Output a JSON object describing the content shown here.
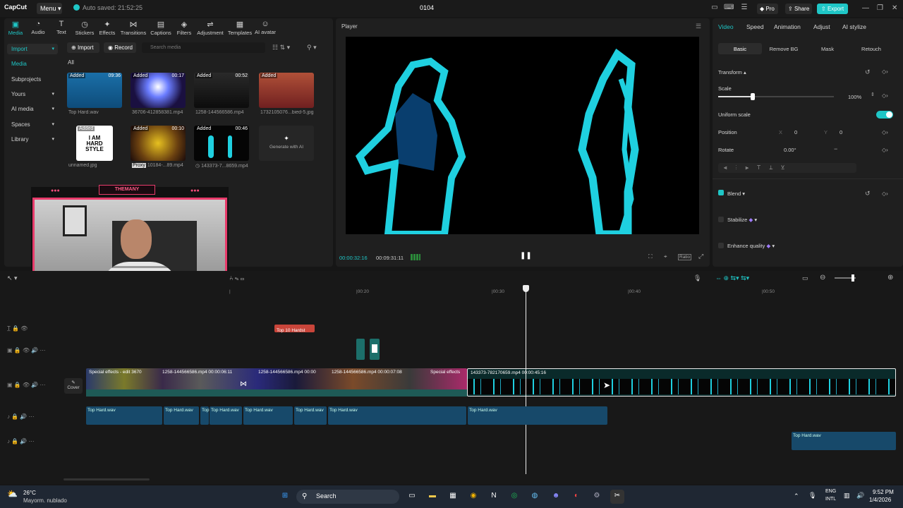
{
  "titlebar": {
    "logo": "CapCut",
    "menu": "Menu",
    "autosave": "Auto saved: 21:52:25",
    "project": "0104",
    "pro": "Pro",
    "share": "Share",
    "export": "Export"
  },
  "toolbar": {
    "items": [
      "Media",
      "Audio",
      "Text",
      "Stickers",
      "Effects",
      "Transitions",
      "Captions",
      "Filters",
      "Adjustment",
      "Templates",
      "AI avatar"
    ]
  },
  "media": {
    "nav": [
      "Import",
      "Media",
      "Subprojects",
      "Yours",
      "AI media",
      "Spaces",
      "Library"
    ],
    "import_btn": "Import",
    "record_btn": "Record",
    "search_placeholder": "Search media",
    "filter_all": "All",
    "items": [
      {
        "name": "Top Hard.wav",
        "tag": "Added",
        "dur": "09:36"
      },
      {
        "name": "36706-412858381.mp4",
        "tag": "Added",
        "dur": "00:17"
      },
      {
        "name": "1258-144566586.mp4",
        "tag": "Added",
        "dur": "00:52"
      },
      {
        "name": "1732105076...bied-5.jpg",
        "tag": "Added",
        "dur": ""
      },
      {
        "name": "unnamed.jpg",
        "tag": "Added",
        "dur": ""
      },
      {
        "name": "10184-...89.mp4",
        "tag": "Added",
        "dur": "00:10",
        "proxy": "Proxy"
      },
      {
        "name": "143373-7...8659.mp4",
        "tag": "Added",
        "dur": "00:46"
      }
    ],
    "generate": "Generate with AI",
    "i_am_hardstyle": "I AM HARD STYLE"
  },
  "webcam": {
    "label": "THEMANY"
  },
  "player": {
    "title": "Player",
    "current_time": "00:00:32:16",
    "total_time": "00:09:31:11",
    "ratio": "Ratio"
  },
  "props": {
    "tabs": [
      "Video",
      "Speed",
      "Animation",
      "Adjust",
      "AI stylize"
    ],
    "subtabs": [
      "Basic",
      "Remove BG",
      "Mask",
      "Retouch"
    ],
    "transform": "Transform",
    "scale_label": "Scale",
    "scale_value": "100%",
    "scale": 0.3,
    "uniform_scale": "Uniform scale",
    "position": "Position",
    "pos_x_label": "X",
    "pos_x": "0",
    "pos_y_label": "Y",
    "pos_y": "0",
    "rotate": "Rotate",
    "rotate_value": "0.00°",
    "blend": "Blend",
    "stabilize": "Stabilize",
    "enhance": "Enhance quality"
  },
  "timeline": {
    "ruler": [
      "|00:20",
      "|00:30",
      "|00:40",
      "|00:50"
    ],
    "text_clip": "Top 10 Hardst",
    "cover": "Cover",
    "video_clips": [
      "Special effects - edit  3670",
      "1258-144566586.mp4  00:00:06:11",
      "1258-144566586.mp4  00:00",
      "1258-144566586.mp4  00:00:07:08",
      "Special effects",
      "143373-782170659.mp4  00:00:45:16"
    ],
    "audio_clips": [
      "Top Hard.wav",
      "Top Hard.wav",
      "Top",
      "Top Hard.wav",
      "Top Hard.wav",
      "Top Hard.wav",
      "Top Hard.wav",
      "Top Hard.wav"
    ]
  },
  "taskbar": {
    "temp": "26°C",
    "weather": "Mayorm. nublado",
    "search": "Search",
    "lang1": "ENG",
    "lang2": "INTL",
    "time": "9:52 PM",
    "date": "1/4/2026"
  }
}
